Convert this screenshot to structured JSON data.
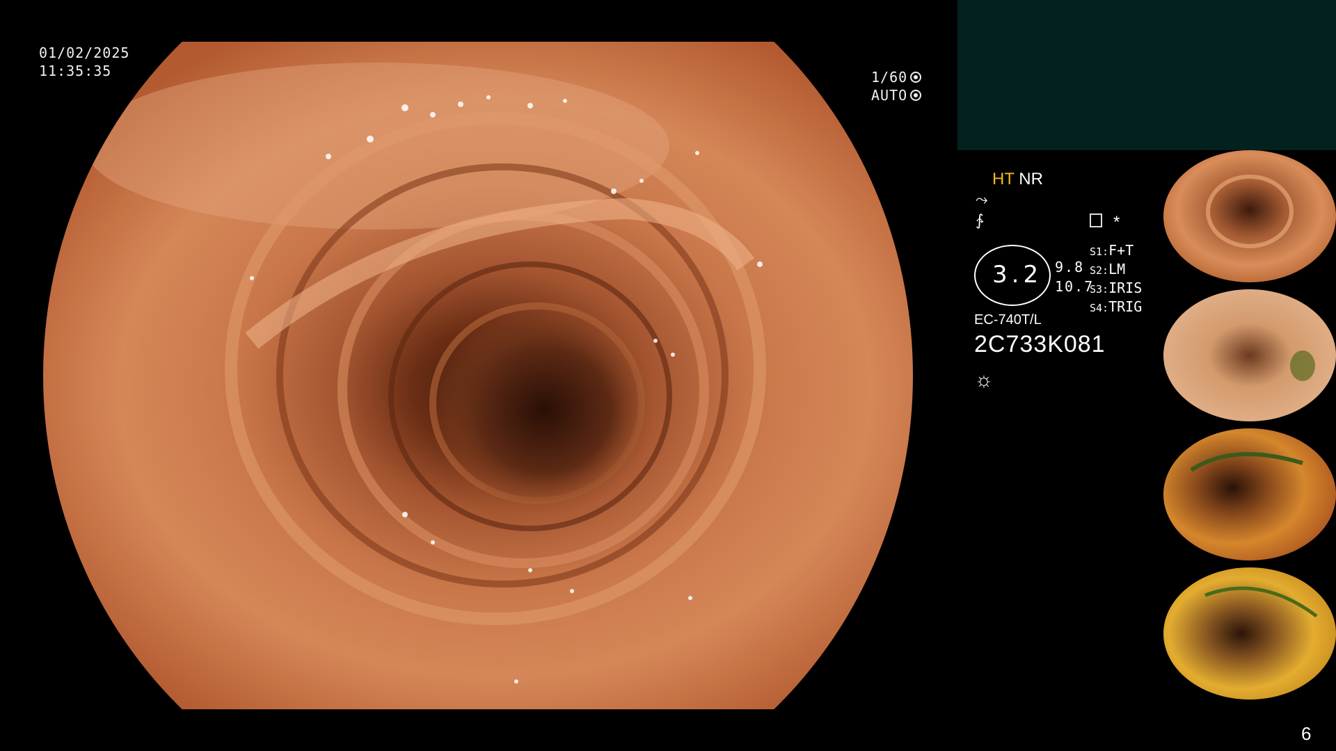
{
  "overlay": {
    "date": "01/02/2025",
    "time": "11:35:35",
    "shutter": "1/60",
    "exposure_mode": "AUTO"
  },
  "panel": {
    "mode_ht": "HT",
    "mode_nr": "NR",
    "ratio_value": "3.2",
    "side_value_1": "9.8",
    "side_value_2": "10.7",
    "switches": [
      {
        "key": "S1:",
        "value": "F+T"
      },
      {
        "key": "S2:",
        "value": "LM"
      },
      {
        "key": "S3:",
        "value": "IRIS"
      },
      {
        "key": "S4:",
        "value": "TRIG"
      }
    ],
    "asterisk": "*",
    "model": "EC-740T/L",
    "serial": "2C733K081",
    "page_number": "6"
  },
  "colors": {
    "mucosa_light": "#e9a57a",
    "mucosa_mid": "#c7703f",
    "mucosa_dark": "#4a1d0e",
    "panel_box": "#02211f",
    "highlight_text": "#f6b722"
  },
  "icons": [
    "camera-gear-icon",
    "iris-icon",
    "flex-icon",
    "signal-icon",
    "memo-icon",
    "brightness-sun-icon"
  ]
}
